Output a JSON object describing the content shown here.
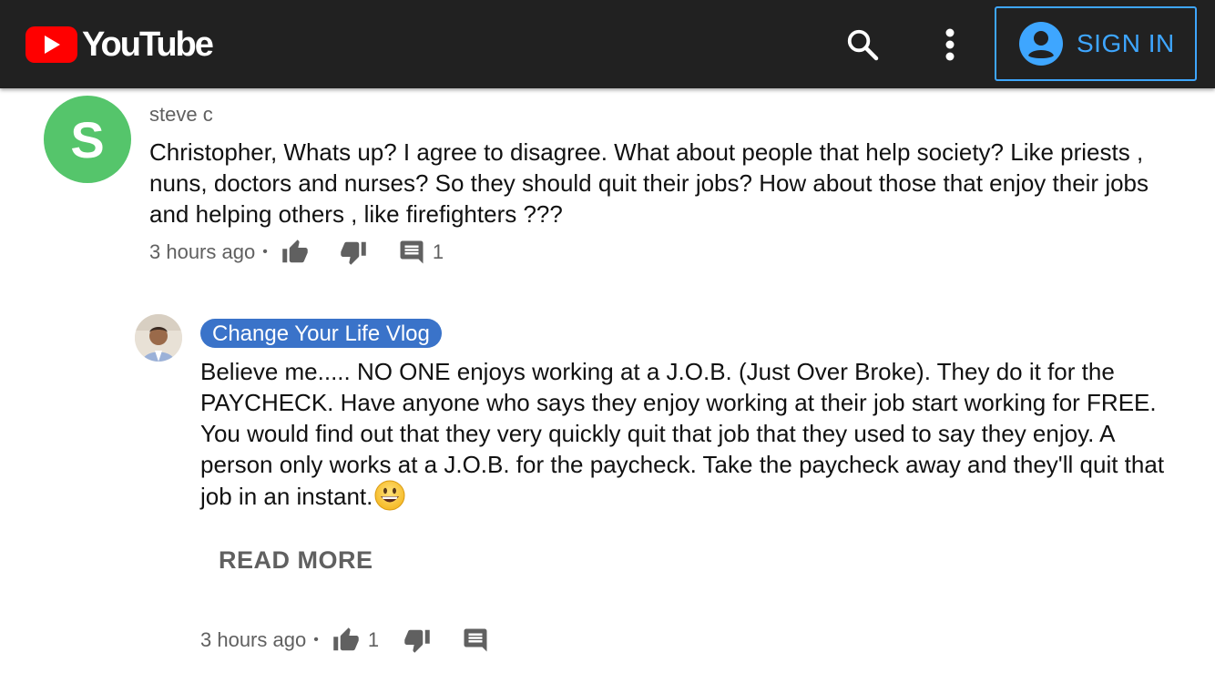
{
  "header": {
    "logo_text": "YouTube",
    "signin_label": "SIGN IN",
    "icons": {
      "search": "search-icon",
      "more": "more-vert-icon",
      "account": "account-circle-icon"
    },
    "colors": {
      "bar": "#212121",
      "brand_red": "#ff0000",
      "signin_blue": "#3ea6ff"
    }
  },
  "comments": [
    {
      "avatar_letter": "S",
      "avatar_color": "#55c56b",
      "author": "steve c",
      "text": "Christopher, Whats up? I agree to disagree. What about people that help society? Like priests , nuns, doctors and nurses? So they should quit their jobs? How about those that enjoy their jobs and helping others , like firefighters ???",
      "time": "3 hours ago",
      "like_count": "",
      "reply_count": "1"
    }
  ],
  "reply": {
    "author": "Change Your Life Vlog",
    "author_badge_color": "#3a73c9",
    "text": "Believe me..... NO ONE enjoys working at a J.O.B. (Just Over Broke). They do it for the PAYCHECK. Have anyone who says they enjoy working at their job start working for FREE. You would find out that they very quickly quit that job that they used to say they enjoy. A person only works at a J.O.B. for the paycheck. Take the paycheck away and they'll quit that job in an instant.",
    "emoji": "grinning-face",
    "read_more": "READ MORE",
    "time": "3 hours ago",
    "like_count": "1"
  },
  "separator": "•"
}
